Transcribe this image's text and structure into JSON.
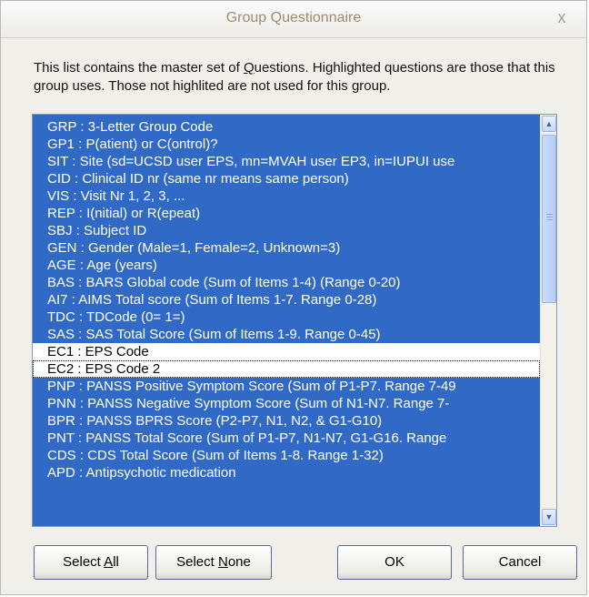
{
  "window": {
    "title": "Group Questionnaire",
    "close_glyph": "x"
  },
  "description": {
    "part1": "This list contains the master set of ",
    "underlined": "Q",
    "part2": "uestions. Highlighted questions are those that this group uses. Those not highlited are not used for this group."
  },
  "list": {
    "items": [
      {
        "text": "GRP : 3-Letter Group Code",
        "selected": true
      },
      {
        "text": "GP1 : P(atient) or C(ontrol)?",
        "selected": true
      },
      {
        "text": "SIT : Site (sd=UCSD user EPS, mn=MVAH user EP3, in=IUPUI use",
        "selected": true
      },
      {
        "text": "CID : Clinical ID nr (same nr means same person)",
        "selected": true
      },
      {
        "text": "VIS : Visit Nr 1, 2, 3, ...",
        "selected": true
      },
      {
        "text": "REP : I(nitial) or R(epeat)",
        "selected": true
      },
      {
        "text": "SBJ : Subject ID",
        "selected": true
      },
      {
        "text": "GEN : Gender (Male=1, Female=2, Unknown=3)",
        "selected": true
      },
      {
        "text": "AGE : Age (years)",
        "selected": true
      },
      {
        "text": "BAS : BARS Global code (Sum of Items 1-4) (Range 0-20)",
        "selected": true
      },
      {
        "text": "AI7 : AIMS Total score (Sum of Items 1-7. Range 0-28)",
        "selected": true
      },
      {
        "text": "TDC : TDCode (0= 1=)",
        "selected": true
      },
      {
        "text": "SAS : SAS Total Score (Sum of Items 1-9. Range 0-45)",
        "selected": true
      },
      {
        "text": "EC1 : EPS Code",
        "selected": false
      },
      {
        "text": "EC2 : EPS Code 2",
        "selected": false,
        "focused": true
      },
      {
        "text": "PNP : PANSS Positive Symptom Score (Sum of P1-P7. Range 7-49",
        "selected": true
      },
      {
        "text": "PNN : PANSS Negative Symptom Score (Sum of N1-N7. Range 7-",
        "selected": true
      },
      {
        "text": "BPR : PANSS BPRS Score (P2-P7, N1, N2, & G1-G10)",
        "selected": true
      },
      {
        "text": "PNT : PANSS Total Score (Sum of P1-P7, N1-N7, G1-G16. Range",
        "selected": true
      },
      {
        "text": "CDS : CDS Total Score (Sum of Items 1-8. Range 1-32)",
        "selected": true
      },
      {
        "text": "APD : Antipsychotic medication",
        "selected": true
      }
    ]
  },
  "scrollbar": {
    "up_glyph": "▲",
    "down_glyph": "▼"
  },
  "buttons": {
    "select_all": {
      "pre": "Select ",
      "accel": "A",
      "post": "ll"
    },
    "select_none": {
      "pre": "Select ",
      "accel": "N",
      "post": "one"
    },
    "ok": "OK",
    "cancel": "Cancel"
  }
}
